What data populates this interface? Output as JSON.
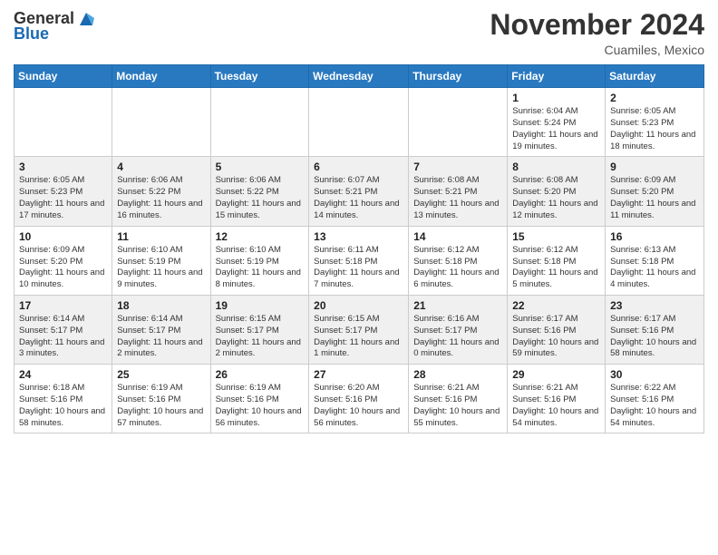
{
  "header": {
    "logo_general": "General",
    "logo_blue": "Blue",
    "month_title": "November 2024",
    "location": "Cuamiles, Mexico"
  },
  "weekdays": [
    "Sunday",
    "Monday",
    "Tuesday",
    "Wednesday",
    "Thursday",
    "Friday",
    "Saturday"
  ],
  "weeks": [
    [
      {
        "day": "",
        "info": ""
      },
      {
        "day": "",
        "info": ""
      },
      {
        "day": "",
        "info": ""
      },
      {
        "day": "",
        "info": ""
      },
      {
        "day": "",
        "info": ""
      },
      {
        "day": "1",
        "info": "Sunrise: 6:04 AM\nSunset: 5:24 PM\nDaylight: 11 hours and 19 minutes."
      },
      {
        "day": "2",
        "info": "Sunrise: 6:05 AM\nSunset: 5:23 PM\nDaylight: 11 hours and 18 minutes."
      }
    ],
    [
      {
        "day": "3",
        "info": "Sunrise: 6:05 AM\nSunset: 5:23 PM\nDaylight: 11 hours and 17 minutes."
      },
      {
        "day": "4",
        "info": "Sunrise: 6:06 AM\nSunset: 5:22 PM\nDaylight: 11 hours and 16 minutes."
      },
      {
        "day": "5",
        "info": "Sunrise: 6:06 AM\nSunset: 5:22 PM\nDaylight: 11 hours and 15 minutes."
      },
      {
        "day": "6",
        "info": "Sunrise: 6:07 AM\nSunset: 5:21 PM\nDaylight: 11 hours and 14 minutes."
      },
      {
        "day": "7",
        "info": "Sunrise: 6:08 AM\nSunset: 5:21 PM\nDaylight: 11 hours and 13 minutes."
      },
      {
        "day": "8",
        "info": "Sunrise: 6:08 AM\nSunset: 5:20 PM\nDaylight: 11 hours and 12 minutes."
      },
      {
        "day": "9",
        "info": "Sunrise: 6:09 AM\nSunset: 5:20 PM\nDaylight: 11 hours and 11 minutes."
      }
    ],
    [
      {
        "day": "10",
        "info": "Sunrise: 6:09 AM\nSunset: 5:20 PM\nDaylight: 11 hours and 10 minutes."
      },
      {
        "day": "11",
        "info": "Sunrise: 6:10 AM\nSunset: 5:19 PM\nDaylight: 11 hours and 9 minutes."
      },
      {
        "day": "12",
        "info": "Sunrise: 6:10 AM\nSunset: 5:19 PM\nDaylight: 11 hours and 8 minutes."
      },
      {
        "day": "13",
        "info": "Sunrise: 6:11 AM\nSunset: 5:18 PM\nDaylight: 11 hours and 7 minutes."
      },
      {
        "day": "14",
        "info": "Sunrise: 6:12 AM\nSunset: 5:18 PM\nDaylight: 11 hours and 6 minutes."
      },
      {
        "day": "15",
        "info": "Sunrise: 6:12 AM\nSunset: 5:18 PM\nDaylight: 11 hours and 5 minutes."
      },
      {
        "day": "16",
        "info": "Sunrise: 6:13 AM\nSunset: 5:18 PM\nDaylight: 11 hours and 4 minutes."
      }
    ],
    [
      {
        "day": "17",
        "info": "Sunrise: 6:14 AM\nSunset: 5:17 PM\nDaylight: 11 hours and 3 minutes."
      },
      {
        "day": "18",
        "info": "Sunrise: 6:14 AM\nSunset: 5:17 PM\nDaylight: 11 hours and 2 minutes."
      },
      {
        "day": "19",
        "info": "Sunrise: 6:15 AM\nSunset: 5:17 PM\nDaylight: 11 hours and 2 minutes."
      },
      {
        "day": "20",
        "info": "Sunrise: 6:15 AM\nSunset: 5:17 PM\nDaylight: 11 hours and 1 minute."
      },
      {
        "day": "21",
        "info": "Sunrise: 6:16 AM\nSunset: 5:17 PM\nDaylight: 11 hours and 0 minutes."
      },
      {
        "day": "22",
        "info": "Sunrise: 6:17 AM\nSunset: 5:16 PM\nDaylight: 10 hours and 59 minutes."
      },
      {
        "day": "23",
        "info": "Sunrise: 6:17 AM\nSunset: 5:16 PM\nDaylight: 10 hours and 58 minutes."
      }
    ],
    [
      {
        "day": "24",
        "info": "Sunrise: 6:18 AM\nSunset: 5:16 PM\nDaylight: 10 hours and 58 minutes."
      },
      {
        "day": "25",
        "info": "Sunrise: 6:19 AM\nSunset: 5:16 PM\nDaylight: 10 hours and 57 minutes."
      },
      {
        "day": "26",
        "info": "Sunrise: 6:19 AM\nSunset: 5:16 PM\nDaylight: 10 hours and 56 minutes."
      },
      {
        "day": "27",
        "info": "Sunrise: 6:20 AM\nSunset: 5:16 PM\nDaylight: 10 hours and 56 minutes."
      },
      {
        "day": "28",
        "info": "Sunrise: 6:21 AM\nSunset: 5:16 PM\nDaylight: 10 hours and 55 minutes."
      },
      {
        "day": "29",
        "info": "Sunrise: 6:21 AM\nSunset: 5:16 PM\nDaylight: 10 hours and 54 minutes."
      },
      {
        "day": "30",
        "info": "Sunrise: 6:22 AM\nSunset: 5:16 PM\nDaylight: 10 hours and 54 minutes."
      }
    ]
  ]
}
